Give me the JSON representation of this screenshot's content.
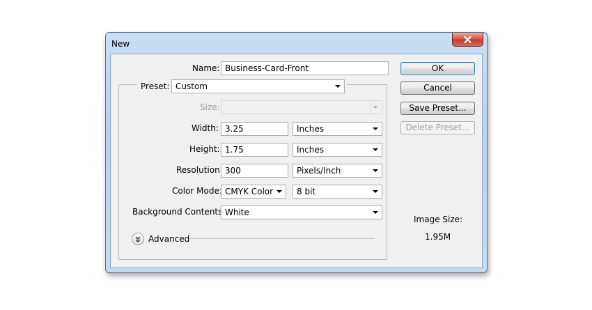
{
  "window": {
    "title": "New"
  },
  "name": {
    "label": "Name:",
    "value": "Business-Card-Front"
  },
  "preset": {
    "label": "Preset:",
    "value": "Custom"
  },
  "size": {
    "label": "Size:",
    "value": ""
  },
  "width": {
    "label": "Width:",
    "value": "3.25",
    "unit": "Inches"
  },
  "height": {
    "label": "Height:",
    "value": "1.75",
    "unit": "Inches"
  },
  "resolution": {
    "label": "Resolution:",
    "value": "300",
    "unit": "Pixels/Inch"
  },
  "color_mode": {
    "label": "Color Mode:",
    "value": "CMYK Color",
    "depth": "8 bit"
  },
  "background": {
    "label": "Background Contents:",
    "value": "White"
  },
  "advanced": {
    "label": "Advanced"
  },
  "buttons": {
    "ok": "OK",
    "cancel": "Cancel",
    "save_preset": "Save Preset...",
    "delete_preset": "Delete Preset..."
  },
  "image_size": {
    "label": "Image Size:",
    "value": "1.95M"
  },
  "icons": {
    "close": "close-icon",
    "dropdown": "chevron-down-icon",
    "advanced": "double-chevron-down-icon"
  },
  "colors": {
    "default_button_border": "#3c7fb1",
    "close_button": "#c94a3a",
    "window_frame": "#b9d2ec",
    "disabled_text": "#a0a0a0"
  }
}
